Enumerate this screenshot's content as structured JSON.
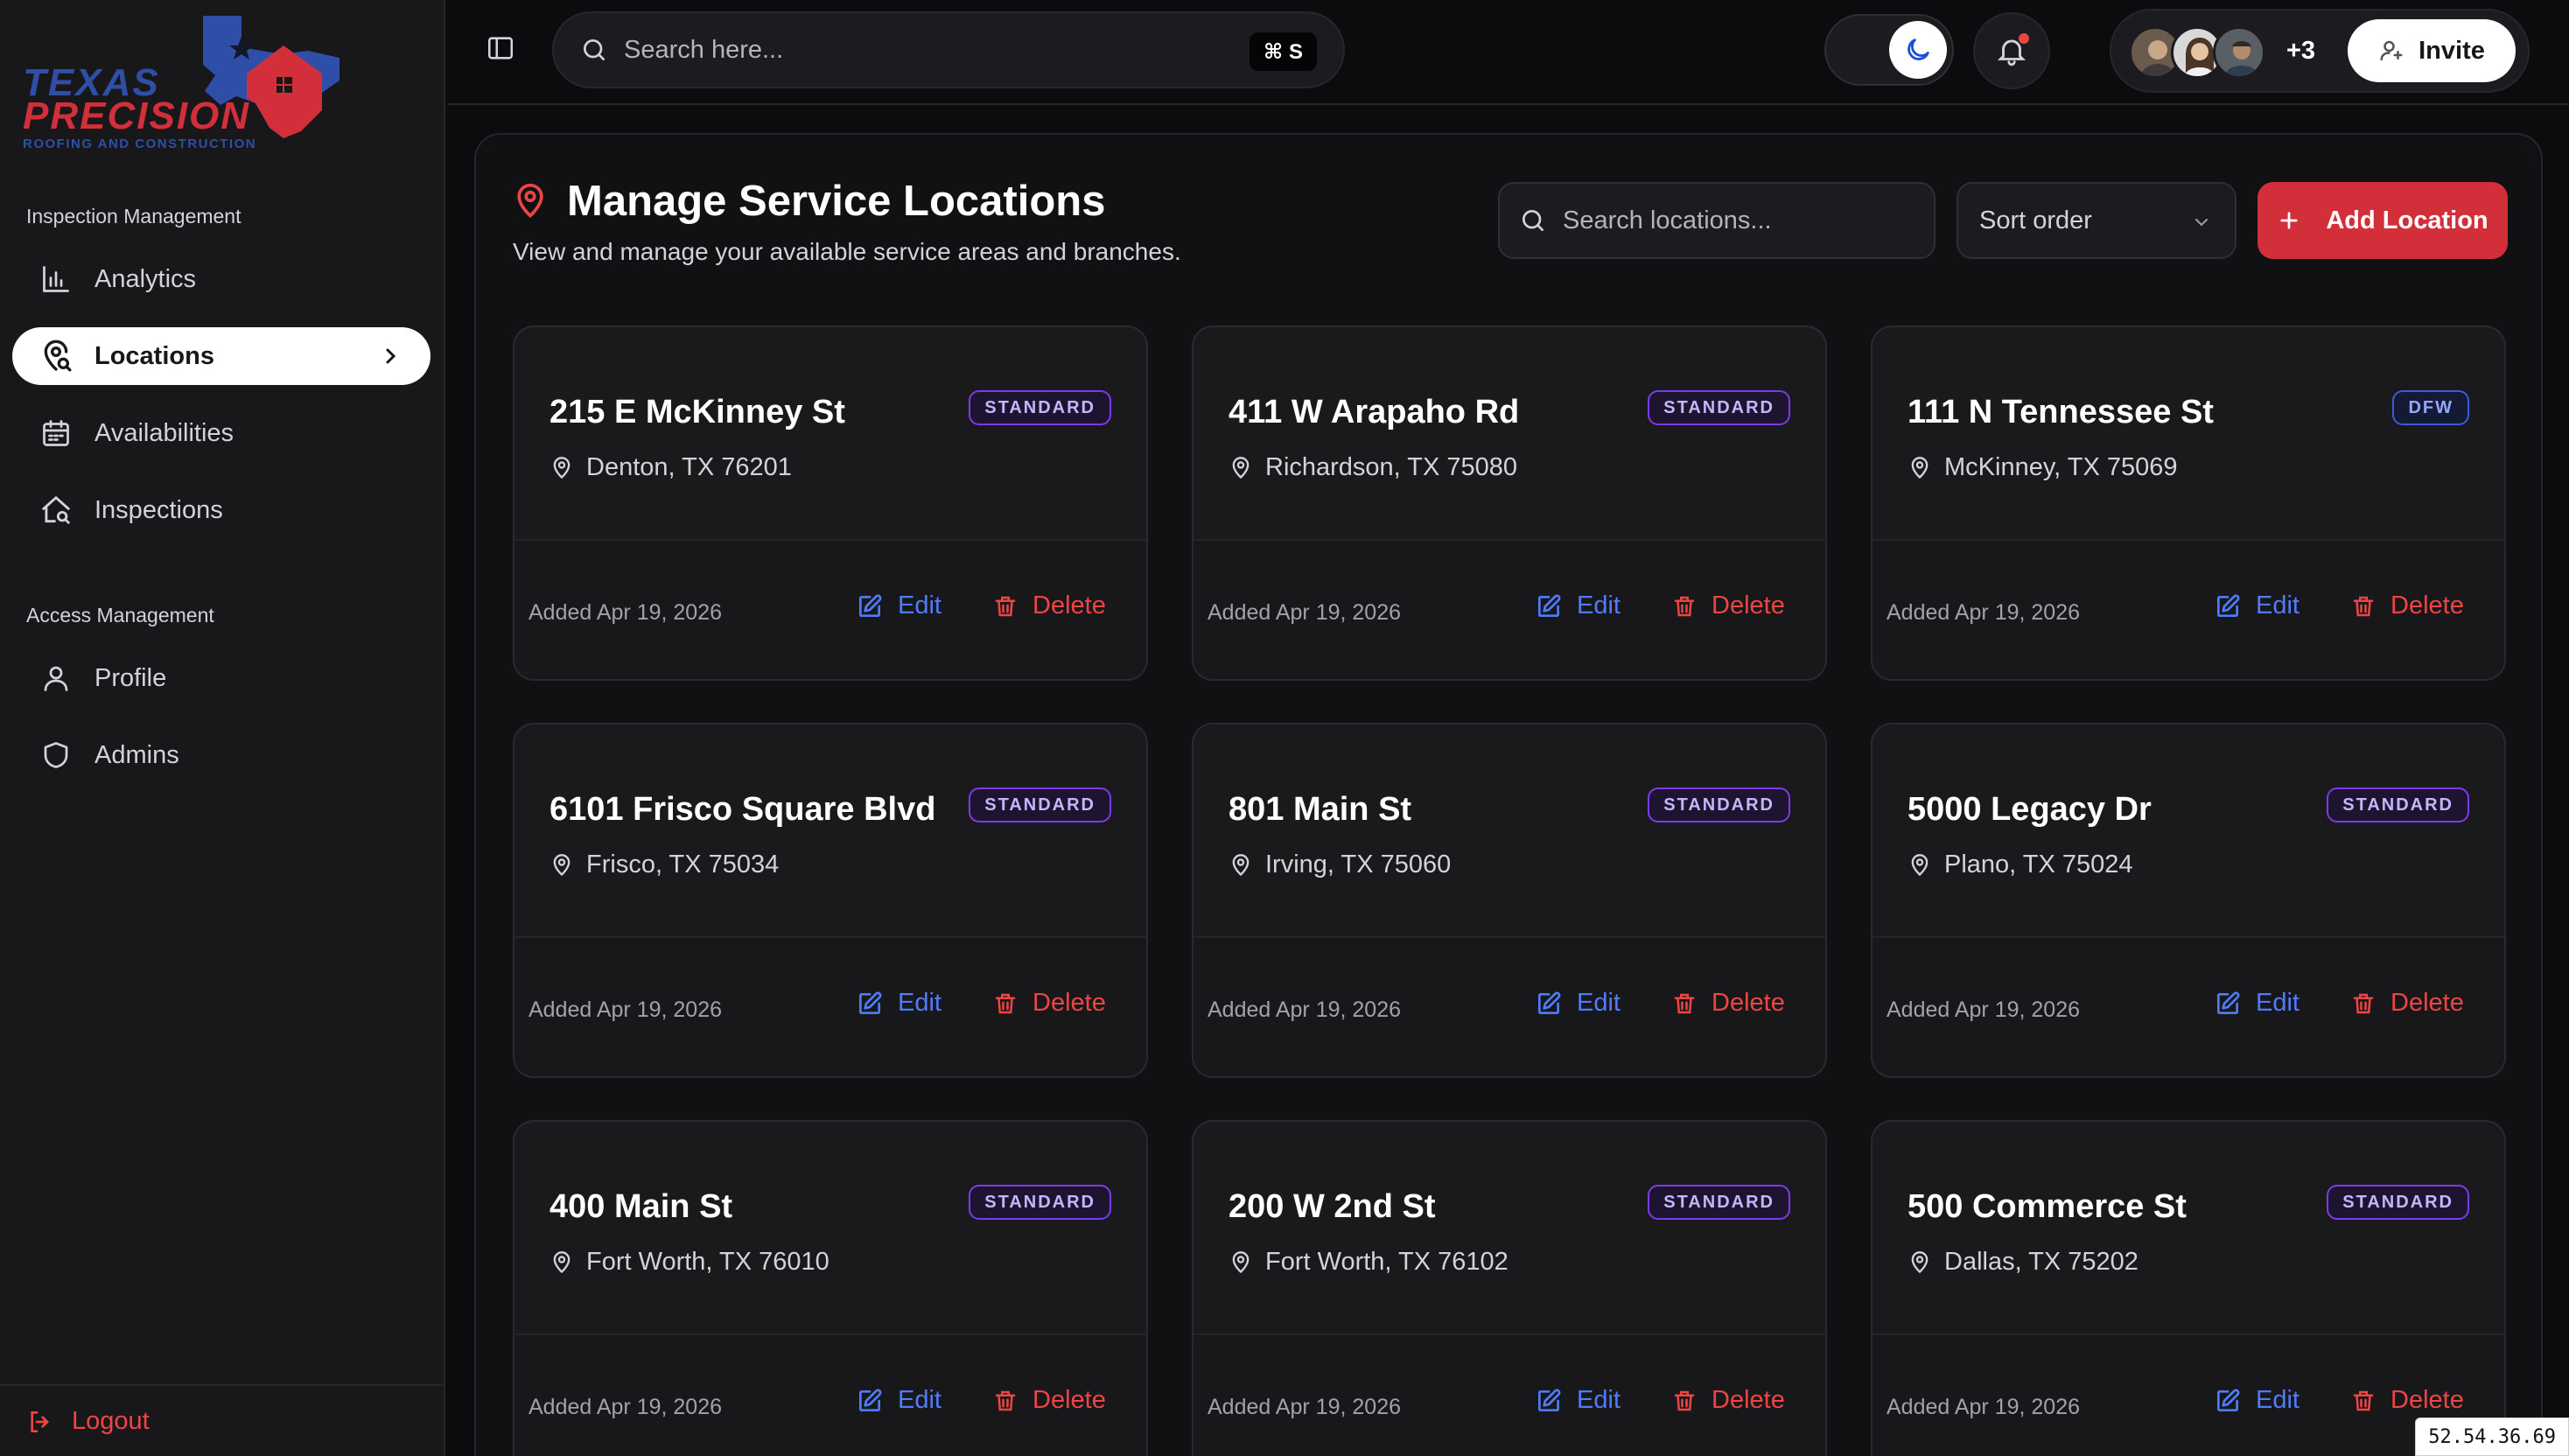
{
  "brand": {
    "line1": "TEXAS",
    "line2": "PRECISION",
    "tagline": "ROOFING AND CONSTRUCTION",
    "colors": {
      "blue": "#2f4ea8",
      "red": "#d32f3a"
    }
  },
  "sidebar": {
    "section1": "Inspection Management",
    "section2": "Access Management",
    "items": [
      {
        "label": "Analytics",
        "icon": "bar-chart-icon",
        "active": false
      },
      {
        "label": "Locations",
        "icon": "map-pin-search-icon",
        "active": true
      },
      {
        "label": "Availabilities",
        "icon": "calendar-icon",
        "active": false
      },
      {
        "label": "Inspections",
        "icon": "house-search-icon",
        "active": false
      },
      {
        "label": "Profile",
        "icon": "user-icon",
        "active": false
      },
      {
        "label": "Admins",
        "icon": "shield-icon",
        "active": false
      }
    ],
    "logout": "Logout"
  },
  "topbar": {
    "search_placeholder": "Search here...",
    "shortcut": "⌘ S",
    "team_more": "+3",
    "invite": "Invite"
  },
  "main": {
    "title": "Manage Service Locations",
    "subtitle": "View and manage your available service areas and branches.",
    "search_placeholder": "Search locations...",
    "sort_label": "Sort order",
    "add_label": "Add Location",
    "edit_label": "Edit",
    "delete_label": "Delete",
    "locations": [
      {
        "street": "215 E McKinney St",
        "city": "Denton, TX 76201",
        "badge": "STANDARD",
        "added": "Added Apr 19, 2026"
      },
      {
        "street": "411 W Arapaho Rd",
        "city": "Richardson, TX 75080",
        "badge": "STANDARD",
        "added": "Added Apr 19, 2026"
      },
      {
        "street": "111 N Tennessee St",
        "city": "McKinney, TX 75069",
        "badge": "DFW",
        "added": "Added Apr 19, 2026"
      },
      {
        "street": "6101 Frisco Square Blvd",
        "city": "Frisco, TX 75034",
        "badge": "STANDARD",
        "added": "Added Apr 19, 2026"
      },
      {
        "street": "801 Main St",
        "city": "Irving, TX 75060",
        "badge": "STANDARD",
        "added": "Added Apr 19, 2026"
      },
      {
        "street": "5000 Legacy Dr",
        "city": "Plano, TX 75024",
        "badge": "STANDARD",
        "added": "Added Apr 19, 2026"
      },
      {
        "street": "400 Main St",
        "city": "Fort Worth, TX 76010",
        "badge": "STANDARD",
        "added": "Added Apr 19, 2026"
      },
      {
        "street": "200 W 2nd St",
        "city": "Fort Worth, TX 76102",
        "badge": "STANDARD",
        "added": "Added Apr 19, 2026"
      },
      {
        "street": "500 Commerce St",
        "city": "Dallas, TX 75202",
        "badge": "STANDARD",
        "added": "Added Apr 19, 2026"
      }
    ]
  },
  "ip_address": "52.54.36.69"
}
